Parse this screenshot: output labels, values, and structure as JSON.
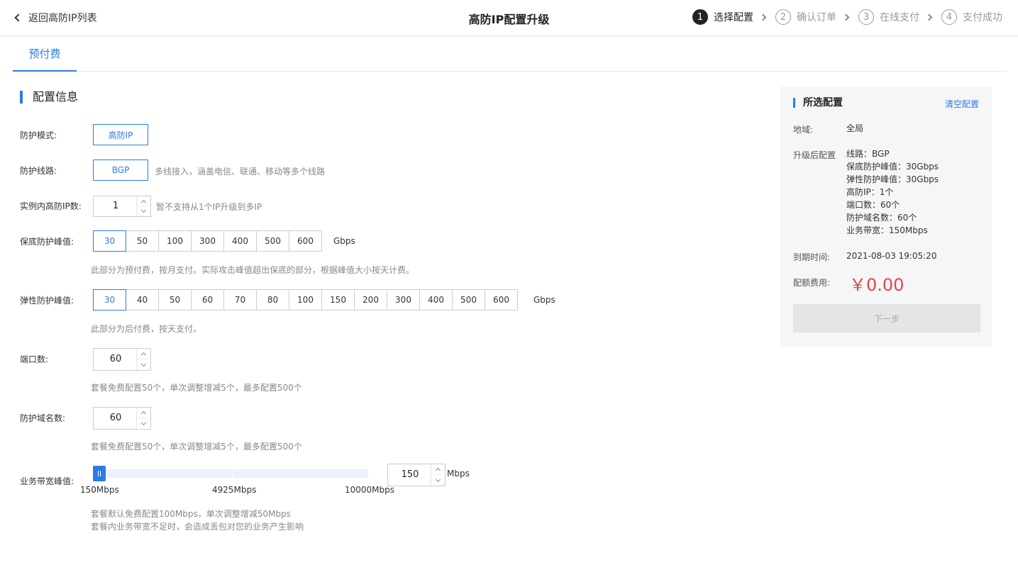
{
  "header": {
    "back_label": "返回高防IP列表",
    "title": "高防IP配置升级",
    "steps": [
      {
        "num": "1",
        "label": "选择配置"
      },
      {
        "num": "2",
        "label": "确认订单"
      },
      {
        "num": "3",
        "label": "在线支付"
      },
      {
        "num": "4",
        "label": "支付成功"
      }
    ]
  },
  "tabs": [
    {
      "label": "预付费"
    }
  ],
  "section_title": "配置信息",
  "form": {
    "mode": {
      "label": "防护模式:",
      "option": "高防IP"
    },
    "line": {
      "label": "防护线路:",
      "option": "BGP",
      "hint": "多线接入，涵盖电信、联通、移动等多个线路"
    },
    "ip_count": {
      "label": "实例内高防IP数:",
      "value": "1",
      "hint": "暂不支持从1个IP升级到多IP"
    },
    "base_peak": {
      "label": "保底防护峰值:",
      "options": [
        "30",
        "50",
        "100",
        "300",
        "400",
        "500",
        "600"
      ],
      "selected": "30",
      "unit": "Gbps",
      "hint": "此部分为预付费，按月支付。实际攻击峰值超出保底的部分，根据峰值大小按天计费。"
    },
    "elastic_peak": {
      "label": "弹性防护峰值:",
      "options": [
        "30",
        "40",
        "50",
        "60",
        "70",
        "80",
        "100",
        "150",
        "200",
        "300",
        "400",
        "500",
        "600"
      ],
      "selected": "30",
      "unit": "Gbps",
      "hint": "此部分为后付费，按天支付。"
    },
    "ports": {
      "label": "端口数:",
      "value": "60",
      "hint": "套餐免费配置50个，单次调整增减5个，最多配置500个"
    },
    "domains": {
      "label": "防护域名数:",
      "value": "60",
      "hint": "套餐免费配置50个，单次调整增减5个，最多配置500个"
    },
    "bandwidth": {
      "label": "业务带宽峰值:",
      "value": "150",
      "unit": "Mbps",
      "min_label": "150Mbps",
      "mid_label": "4925Mbps",
      "max_label": "10000Mbps",
      "min": 150,
      "max": 10000,
      "current": 150,
      "hint1": "套餐默认免费配置100Mbps，单次调整增减50Mbps",
      "hint2": "套餐内业务带宽不足时，会造成丢包对您的业务产生影响"
    }
  },
  "summary": {
    "title": "所选配置",
    "clear_label": "清空配置",
    "region_label": "地域:",
    "region_value": "全局",
    "upgrade_label": "升级后配置",
    "upgrade_lines": [
      "线路：BGP",
      "保底防护峰值：30Gbps",
      "弹性防护峰值：30Gbps",
      "高防IP：1个",
      "端口数：60个",
      "防护域名数：60个",
      "业务带宽：150Mbps"
    ],
    "expire_label": "到期时间:",
    "expire_value": "2021-08-03 19:05:20",
    "fee_label": "配额费用:",
    "fee_value": "￥0.00",
    "next_label": "下一步"
  }
}
